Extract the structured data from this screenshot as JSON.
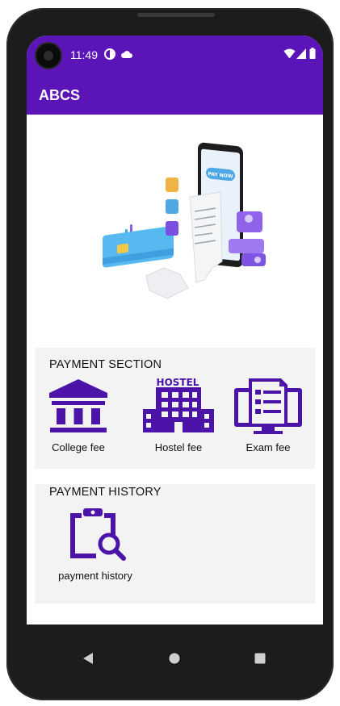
{
  "status_bar": {
    "time": "11:49"
  },
  "app_bar": {
    "title": "ABCS"
  },
  "payment_section": {
    "title": "PAYMENT SECTION",
    "items": [
      {
        "label": "College fee",
        "icon": "college-building-icon"
      },
      {
        "label": "Hostel fee",
        "icon": "hostel-building-icon"
      },
      {
        "label": "Exam fee",
        "icon": "exam-monitor-icon"
      }
    ]
  },
  "payment_history_section": {
    "title": "PAYMENT HISTORY",
    "items": [
      {
        "label": "payment history",
        "icon": "clipboard-search-icon"
      }
    ]
  },
  "hero": {
    "phone_button_text": "PAY NOW",
    "hostel_sign": "HOSTEL"
  },
  "colors": {
    "primary": "#5a14b8",
    "icon": "#4b13a8",
    "section_bg": "#f3f3f3"
  }
}
